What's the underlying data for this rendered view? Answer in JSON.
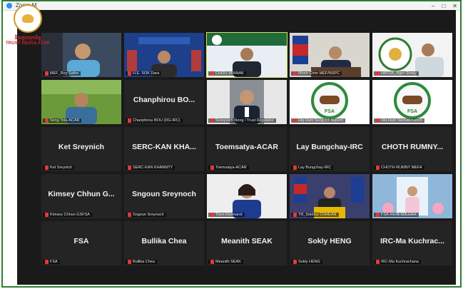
{
  "window": {
    "title": "Zoom M",
    "controls": [
      "–",
      "□",
      "✕"
    ]
  },
  "logo": {
    "khmer": "និយត្តករទុកចិត្ត",
    "english": "TRUST REGULATOR"
  },
  "tiles": [
    {
      "name": "MEF_Roy Sathe",
      "center": "",
      "video": "man-glasses",
      "active": false
    },
    {
      "name": "H.E. SOK Dara",
      "center": "",
      "video": "banner-blue",
      "active": false
    },
    {
      "name": "CHOU VANNAK",
      "center": "",
      "video": "banner-green",
      "active": true
    },
    {
      "name": "Monh Chim MEF/NSPC",
      "center": "",
      "video": "man-flag",
      "active": false
    },
    {
      "name": "HBFSA_Ngor Sinaly",
      "center": "",
      "video": "man-logo",
      "active": false
    },
    {
      "name": "Seng Tola-ACAR",
      "center": "",
      "video": "man-field",
      "active": false
    },
    {
      "name": "Chanphirou BOU (DG-IRC)",
      "center": "Chanphirou BO...",
      "video": "",
      "active": false
    },
    {
      "name": "Soreyvuth Nong / Trust Regulator",
      "center": "",
      "video": "man-suit",
      "active": false
    },
    {
      "name": "Hiq Hum Seng (IT Suport)",
      "center": "",
      "video": "fsa-logo",
      "active": false
    },
    {
      "name": "Hiq Hum Vannak-Lunch",
      "center": "",
      "video": "fsa-logo",
      "active": false
    },
    {
      "name": "Ket Sreynich",
      "center": "Ket Sreynich",
      "video": "",
      "active": false
    },
    {
      "name": "SERC-KAN KHANNTY",
      "center": "SERC-KAN KHA...",
      "video": "",
      "active": false
    },
    {
      "name": "Toemsatya-ACAR",
      "center": "Toemsatya-ACAR",
      "video": "",
      "active": false
    },
    {
      "name": "Lay Bungchay-IRC",
      "center": "Lay Bungchay-IRC",
      "video": "",
      "active": false
    },
    {
      "name": "CHOTH RUMNY MEFA",
      "center": "CHOTH RUMNY...",
      "video": "",
      "active": false
    },
    {
      "name": "Kimsey Chhun GSFSA",
      "center": "Kimsey Chhun G...",
      "video": "",
      "active": false
    },
    {
      "name": "Sngoun Sreynoch",
      "center": "Sngoun Sreynoch",
      "video": "",
      "active": false
    },
    {
      "name": "Thon Kimmarot",
      "center": "",
      "video": "woman",
      "active": false
    },
    {
      "name": "TR_Sokhoy CHHEAN",
      "center": "",
      "video": "woman-flag",
      "active": false
    },
    {
      "name": "FSA-HEIN SOLEAH",
      "center": "",
      "video": "portrait-flowers",
      "active": false
    },
    {
      "name": "FSA",
      "center": "FSA",
      "video": "",
      "active": false
    },
    {
      "name": "Bullika Chea",
      "center": "Bullika Chea",
      "video": "",
      "active": false
    },
    {
      "name": "Meanith SEAK",
      "center": "Meanith SEAK",
      "video": "",
      "active": false
    },
    {
      "name": "Sokly HENG",
      "center": "Sokly HENG",
      "video": "",
      "active": false
    },
    {
      "name": "IRC-Ma Kuchrachana",
      "center": "IRC-Ma Kuchrac...",
      "video": "",
      "active": false
    }
  ],
  "colors": {
    "active_border": "#d4e157",
    "tile_bg": "#242424",
    "stage_bg": "#1a1a1a",
    "frame": "#2e7d32",
    "mic_muted": "#e53935"
  }
}
